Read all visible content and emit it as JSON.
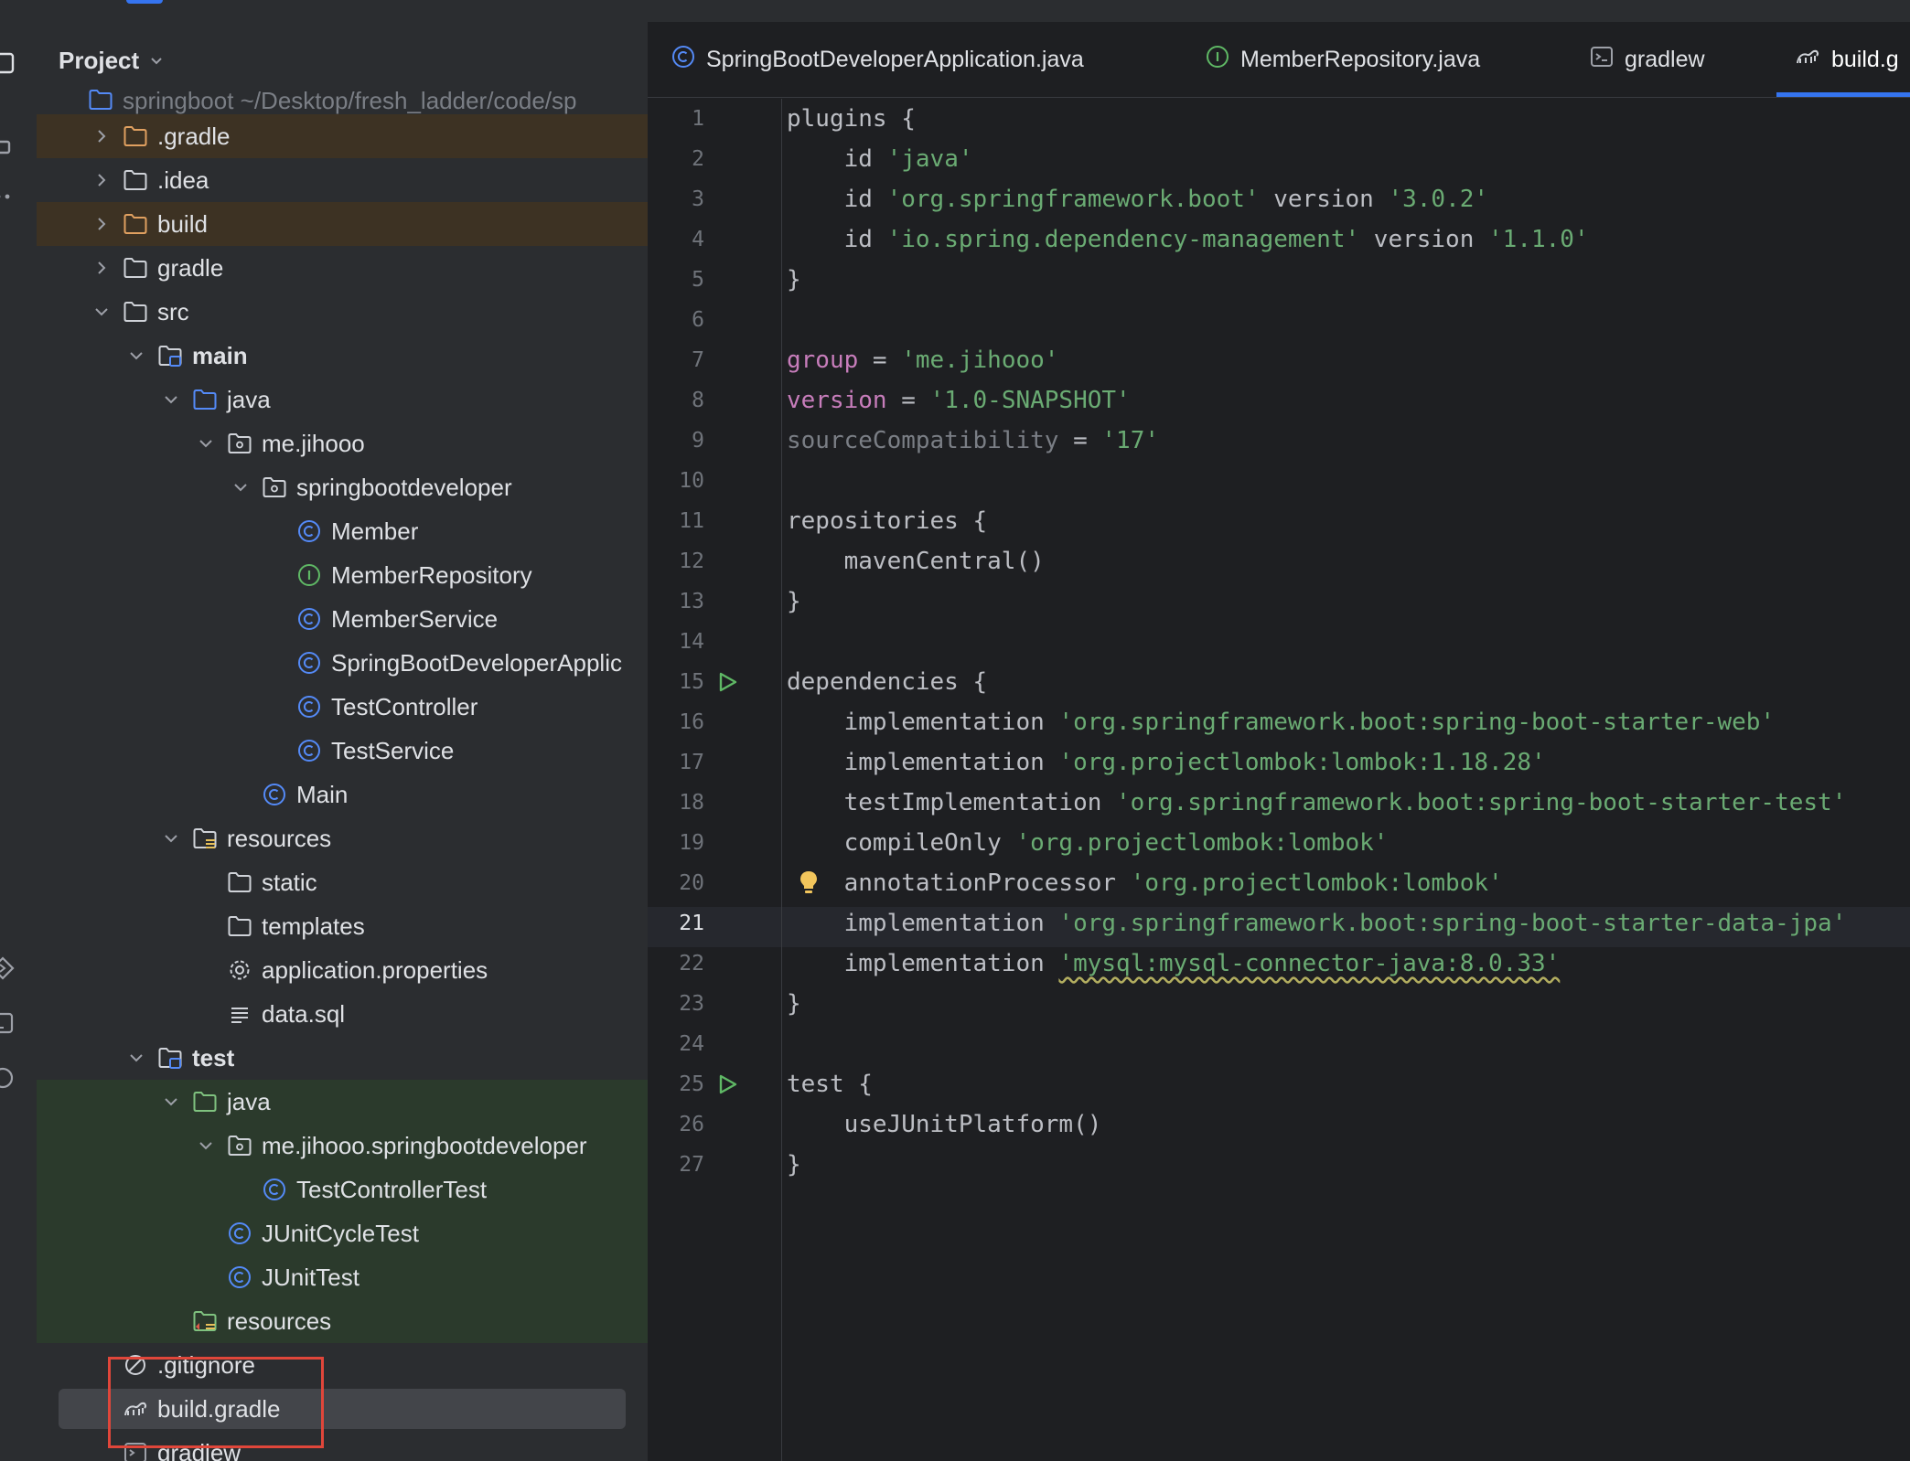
{
  "project_panel": {
    "title": "Project",
    "tree": [
      {
        "label": "springboot  ~/Desktop/fresh_ladder/code/sp",
        "depth": 1,
        "kind": "module",
        "state": "cut",
        "bg": ""
      },
      {
        "label": ".gradle",
        "depth": 2,
        "kind": "folder-orange",
        "state": "collapsed",
        "bg": "excl"
      },
      {
        "label": ".idea",
        "depth": 2,
        "kind": "folder",
        "state": "collapsed",
        "bg": ""
      },
      {
        "label": "build",
        "depth": 2,
        "kind": "folder-orange",
        "state": "collapsed",
        "bg": "excl"
      },
      {
        "label": "gradle",
        "depth": 2,
        "kind": "folder",
        "state": "collapsed",
        "bg": ""
      },
      {
        "label": "src",
        "depth": 2,
        "kind": "folder",
        "state": "expanded",
        "bg": ""
      },
      {
        "label": "main",
        "depth": 3,
        "kind": "module-folder",
        "state": "expanded",
        "bg": "",
        "bold": true
      },
      {
        "label": "java",
        "depth": 4,
        "kind": "folder-blue",
        "state": "expanded",
        "bg": ""
      },
      {
        "label": "me.jihooo",
        "depth": 5,
        "kind": "package",
        "state": "expanded",
        "bg": ""
      },
      {
        "label": "springbootdeveloper",
        "depth": 6,
        "kind": "package",
        "state": "expanded",
        "bg": ""
      },
      {
        "label": "Member",
        "depth": 7,
        "kind": "class",
        "state": "leaf",
        "bg": ""
      },
      {
        "label": "MemberRepository",
        "depth": 7,
        "kind": "interface",
        "state": "leaf",
        "bg": ""
      },
      {
        "label": "MemberService",
        "depth": 7,
        "kind": "class",
        "state": "leaf",
        "bg": ""
      },
      {
        "label": "SpringBootDeveloperApplic",
        "depth": 7,
        "kind": "class",
        "state": "leaf",
        "bg": ""
      },
      {
        "label": "TestController",
        "depth": 7,
        "kind": "class",
        "state": "leaf",
        "bg": ""
      },
      {
        "label": "TestService",
        "depth": 7,
        "kind": "class",
        "state": "leaf",
        "bg": ""
      },
      {
        "label": "Main",
        "depth": 6,
        "kind": "class",
        "state": "leaf",
        "bg": ""
      },
      {
        "label": "resources",
        "depth": 4,
        "kind": "resources",
        "state": "expanded",
        "bg": ""
      },
      {
        "label": "static",
        "depth": 5,
        "kind": "folder",
        "state": "leaf",
        "bg": ""
      },
      {
        "label": "templates",
        "depth": 5,
        "kind": "folder",
        "state": "leaf",
        "bg": ""
      },
      {
        "label": "application.properties",
        "depth": 5,
        "kind": "settings",
        "state": "leaf",
        "bg": ""
      },
      {
        "label": "data.sql",
        "depth": 5,
        "kind": "text",
        "state": "leaf",
        "bg": ""
      },
      {
        "label": "test",
        "depth": 3,
        "kind": "module-folder",
        "state": "expanded",
        "bg": "",
        "bold": true
      },
      {
        "label": "java",
        "depth": 4,
        "kind": "folder-green",
        "state": "expanded",
        "bg": "test"
      },
      {
        "label": "me.jihooo.springbootdeveloper",
        "depth": 5,
        "kind": "package",
        "state": "expanded",
        "bg": "test"
      },
      {
        "label": "TestControllerTest",
        "depth": 6,
        "kind": "class",
        "state": "leaf",
        "bg": "test"
      },
      {
        "label": "JUnitCycleTest",
        "depth": 5,
        "kind": "class",
        "state": "leaf",
        "bg": "test"
      },
      {
        "label": "JUnitTest",
        "depth": 5,
        "kind": "class",
        "state": "leaf",
        "bg": "test"
      },
      {
        "label": "resources",
        "depth": 4,
        "kind": "test-resources",
        "state": "leaf",
        "bg": "test"
      },
      {
        "label": ".gitignore",
        "depth": 2,
        "kind": "ignore",
        "state": "leaf",
        "bg": ""
      },
      {
        "label": "build.gradle",
        "depth": 2,
        "kind": "gradle",
        "state": "leaf",
        "bg": "",
        "selected": true
      },
      {
        "label": "gradlew",
        "depth": 2,
        "kind": "terminal",
        "state": "leaf",
        "bg": ""
      }
    ]
  },
  "editor": {
    "tabs": [
      {
        "label": "SpringBootDeveloperApplication.java",
        "icon": "class"
      },
      {
        "label": "MemberRepository.java",
        "icon": "interface"
      },
      {
        "label": "gradlew",
        "icon": "terminal"
      },
      {
        "label": "build.g",
        "icon": "gradle",
        "active": true
      }
    ],
    "current_line": 21,
    "run_lines": [
      15,
      25
    ],
    "bulb_line": 20,
    "lines": [
      [
        {
          "t": "plugins {",
          "c": "kw"
        }
      ],
      [
        {
          "t": "    id ",
          "c": "kw"
        },
        {
          "t": "'java'",
          "c": "str"
        }
      ],
      [
        {
          "t": "    id ",
          "c": "kw"
        },
        {
          "t": "'org.springframework.boot'",
          "c": "str"
        },
        {
          "t": " version ",
          "c": "kw"
        },
        {
          "t": "'3.0.2'",
          "c": "str"
        }
      ],
      [
        {
          "t": "    id ",
          "c": "kw"
        },
        {
          "t": "'io.spring.dependency-management'",
          "c": "str"
        },
        {
          "t": " version ",
          "c": "kw"
        },
        {
          "t": "'1.1.0'",
          "c": "str"
        }
      ],
      [
        {
          "t": "}",
          "c": "kw"
        }
      ],
      [],
      [
        {
          "t": "group",
          "c": "prop"
        },
        {
          "t": " = ",
          "c": "kw"
        },
        {
          "t": "'me.jihooo'",
          "c": "str"
        }
      ],
      [
        {
          "t": "version",
          "c": "prop"
        },
        {
          "t": " = ",
          "c": "kw"
        },
        {
          "t": "'1.0-SNAPSHOT'",
          "c": "str"
        }
      ],
      [
        {
          "t": "sourceCompatibility",
          "c": "dim"
        },
        {
          "t": " = ",
          "c": "kw"
        },
        {
          "t": "'17'",
          "c": "str"
        }
      ],
      [],
      [
        {
          "t": "repositories {",
          "c": "kw"
        }
      ],
      [
        {
          "t": "    mavenCentral()",
          "c": "kw"
        }
      ],
      [
        {
          "t": "}",
          "c": "kw"
        }
      ],
      [],
      [
        {
          "t": "dependencies {",
          "c": "kw"
        }
      ],
      [
        {
          "t": "    implementation ",
          "c": "kw"
        },
        {
          "t": "'org.springframework.boot:spring-boot-starter-web'",
          "c": "str"
        }
      ],
      [
        {
          "t": "    implementation ",
          "c": "kw"
        },
        {
          "t": "'org.projectlombok:lombok:1.18.28'",
          "c": "str"
        }
      ],
      [
        {
          "t": "    testImplementation ",
          "c": "kw"
        },
        {
          "t": "'org.springframework.boot:spring-boot-starter-test'",
          "c": "str"
        }
      ],
      [
        {
          "t": "    compileOnly ",
          "c": "kw"
        },
        {
          "t": "'org.projectlombok:lombok'",
          "c": "str"
        }
      ],
      [
        {
          "t": "    annotationProcessor ",
          "c": "kw"
        },
        {
          "t": "'org.projectlombok:lombok'",
          "c": "str"
        }
      ],
      [
        {
          "t": "    implementation ",
          "c": "kw"
        },
        {
          "t": "'org.springframework.boot:spring-boot-starter-data-jpa'",
          "c": "str"
        }
      ],
      [
        {
          "t": "    implementation ",
          "c": "kw"
        },
        {
          "t": "'mysql:mysql-connector-java:8.0.33'",
          "c": "str warn"
        }
      ],
      [
        {
          "t": "}",
          "c": "kw"
        }
      ],
      [],
      [
        {
          "t": "test {",
          "c": "kw"
        }
      ],
      [
        {
          "t": "    useJUnitPlatform()",
          "c": "kw"
        }
      ],
      [
        {
          "t": "}",
          "c": "kw"
        }
      ]
    ]
  },
  "colors": {
    "accent": "#3574f0",
    "string": "#6aab73",
    "property": "#c77dbb",
    "highlight_box": "#e0463a"
  }
}
